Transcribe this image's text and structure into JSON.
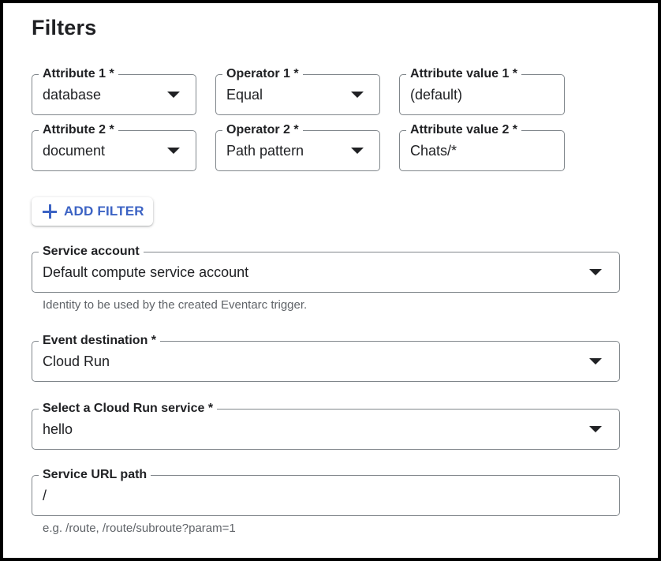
{
  "section": {
    "title": "Filters"
  },
  "filters": [
    {
      "attribute": {
        "label": "Attribute 1 *",
        "value": "database"
      },
      "operator": {
        "label": "Operator 1 *",
        "value": "Equal"
      },
      "attribute_value": {
        "label": "Attribute value 1 *",
        "value": "(default)"
      }
    },
    {
      "attribute": {
        "label": "Attribute 2 *",
        "value": "document"
      },
      "operator": {
        "label": "Operator 2 *",
        "value": "Path pattern"
      },
      "attribute_value": {
        "label": "Attribute value 2 *",
        "value": "Chats/*"
      }
    }
  ],
  "add_filter": {
    "label": "ADD FILTER",
    "icon": "plus-icon",
    "color": "#3c63c4"
  },
  "service_account": {
    "label": "Service account",
    "value": "Default compute service account",
    "helper": "Identity to be used by the created Eventarc trigger."
  },
  "event_destination": {
    "label": "Event destination *",
    "value": "Cloud Run"
  },
  "cloud_run_service": {
    "label": "Select a Cloud Run service *",
    "value": "hello"
  },
  "service_url_path": {
    "label": "Service URL path",
    "value": "/",
    "helper": "e.g. /route, /route/subroute?param=1"
  }
}
